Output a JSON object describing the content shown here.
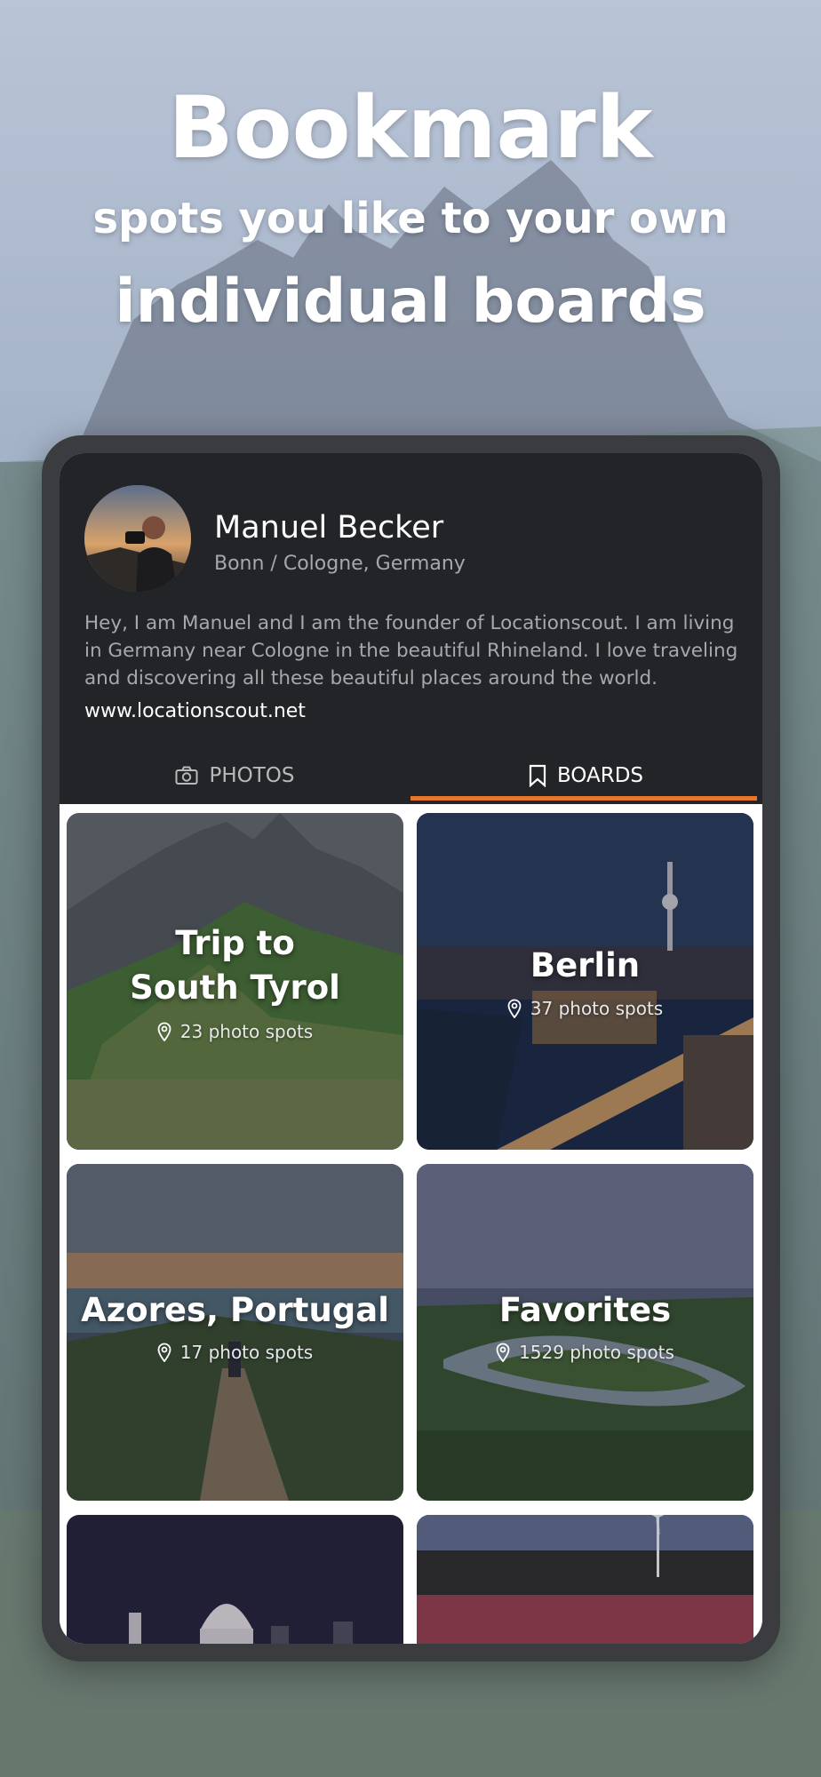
{
  "headline": {
    "line1": "Bookmark",
    "line2": "spots you like to your own",
    "line3": "individual boards"
  },
  "profile": {
    "name": "Manuel Becker",
    "location": "Bonn / Cologne, Germany",
    "bio": "Hey, I am Manuel and I am the founder of Locationscout. I am living in Germany near Cologne in the beautiful Rhineland. I love traveling and discovering all these beautiful places around the world.",
    "website": "www.locationscout.net"
  },
  "tabs": [
    {
      "label": "PHOTOS",
      "icon": "camera-icon",
      "active": false
    },
    {
      "label": "BOARDS",
      "icon": "bookmark-icon",
      "active": true
    }
  ],
  "boards": [
    {
      "title_line1": "Trip to",
      "title_line2": "South Tyrol",
      "count": "23 photo spots"
    },
    {
      "title_line1": "Berlin",
      "count": "37 photo spots"
    },
    {
      "title_line1": "Azores, Portugal",
      "count": "17 photo spots"
    },
    {
      "title_line1": "Favorites",
      "count": "1529 photo spots"
    }
  ],
  "colors": {
    "accent": "#e8752a",
    "panel": "#232427",
    "frame": "#3a3c40"
  }
}
